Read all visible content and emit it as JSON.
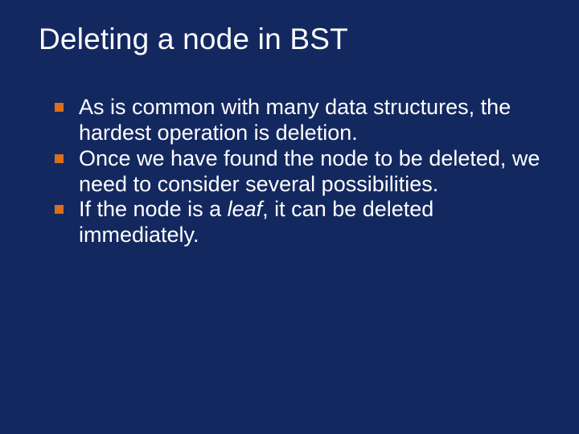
{
  "slide": {
    "title": "Deleting a node in BST",
    "bullets": [
      {
        "text_before": "As is common with many data structures, the hardest operation is deletion.",
        "italic": "",
        "text_after": ""
      },
      {
        "text_before": "Once we have found the node to be deleted, we need to consider several possibilities.",
        "italic": "",
        "text_after": ""
      },
      {
        "text_before": "If the node is a ",
        "italic": "leaf",
        "text_after": ", it can be deleted immediately."
      }
    ]
  }
}
